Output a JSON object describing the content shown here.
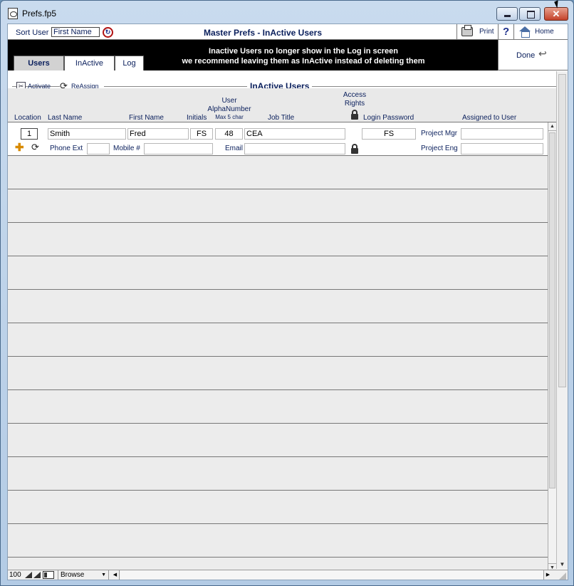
{
  "window": {
    "title": "Prefs.fp5",
    "close_glyph": ""
  },
  "header": {
    "sort_label": "Sort User",
    "sort_value": "First Name",
    "page_title": "Master Prefs - InActive Users",
    "print_label": "Print",
    "help_glyph": "?",
    "home_label": "Home"
  },
  "tabs": [
    {
      "label": "Users",
      "active": true
    },
    {
      "label": "InActive",
      "active": false
    },
    {
      "label": "Log",
      "active": false
    }
  ],
  "notice": {
    "line1": "Inactive Users no longer show in the Log in screen",
    "line2": "we recommend leaving them as InActive instead of deleting them"
  },
  "done_label": "Done",
  "toolbar": {
    "activate_label": "Activate",
    "reassign_label": "ReAssign",
    "section_title": "InActive Users"
  },
  "columns": {
    "location": "Location",
    "last_name": "Last Name",
    "first_name": "First Name",
    "initials": "Initials",
    "user_alpha_1": "User",
    "user_alpha_2": "AlphaNumber",
    "user_alpha_3": "Max 5 char",
    "job_title": "Job Title",
    "access_1": "Access",
    "access_2": "Rights",
    "login_password": "Login Password",
    "assigned_to": "Assigned to User"
  },
  "record": {
    "location": "1",
    "last_name": "Smith",
    "first_name": "Fred",
    "initials": "FS",
    "alpha_number": "48",
    "job_title": "CEA",
    "login_password": "FS",
    "project_mgr_label": "Project Mgr",
    "project_mgr": "",
    "phone_ext_label": "Phone Ext",
    "phone_ext": "",
    "mobile_label": "Mobile #",
    "mobile": "",
    "email_label": "Email",
    "email": "",
    "project_eng_label": "Project Eng",
    "project_eng": ""
  },
  "statusbar": {
    "zoom": "100",
    "mode": "Browse"
  },
  "icons": {
    "sort": "sort-icon",
    "print": "printer-icon",
    "help": "help-icon",
    "home": "home-icon",
    "done": "return-arrow-icon",
    "activate": "activate-icon",
    "reassign": "reassign-icon",
    "lock": "lock-icon",
    "add": "plus-icon",
    "refresh": "refresh-icon"
  },
  "colors": {
    "label_text": "#0a1f5c",
    "band": "#000000",
    "record_bg": "#ececec",
    "add_icon": "#d88a00",
    "sort_icon_ring": "#b01212"
  }
}
